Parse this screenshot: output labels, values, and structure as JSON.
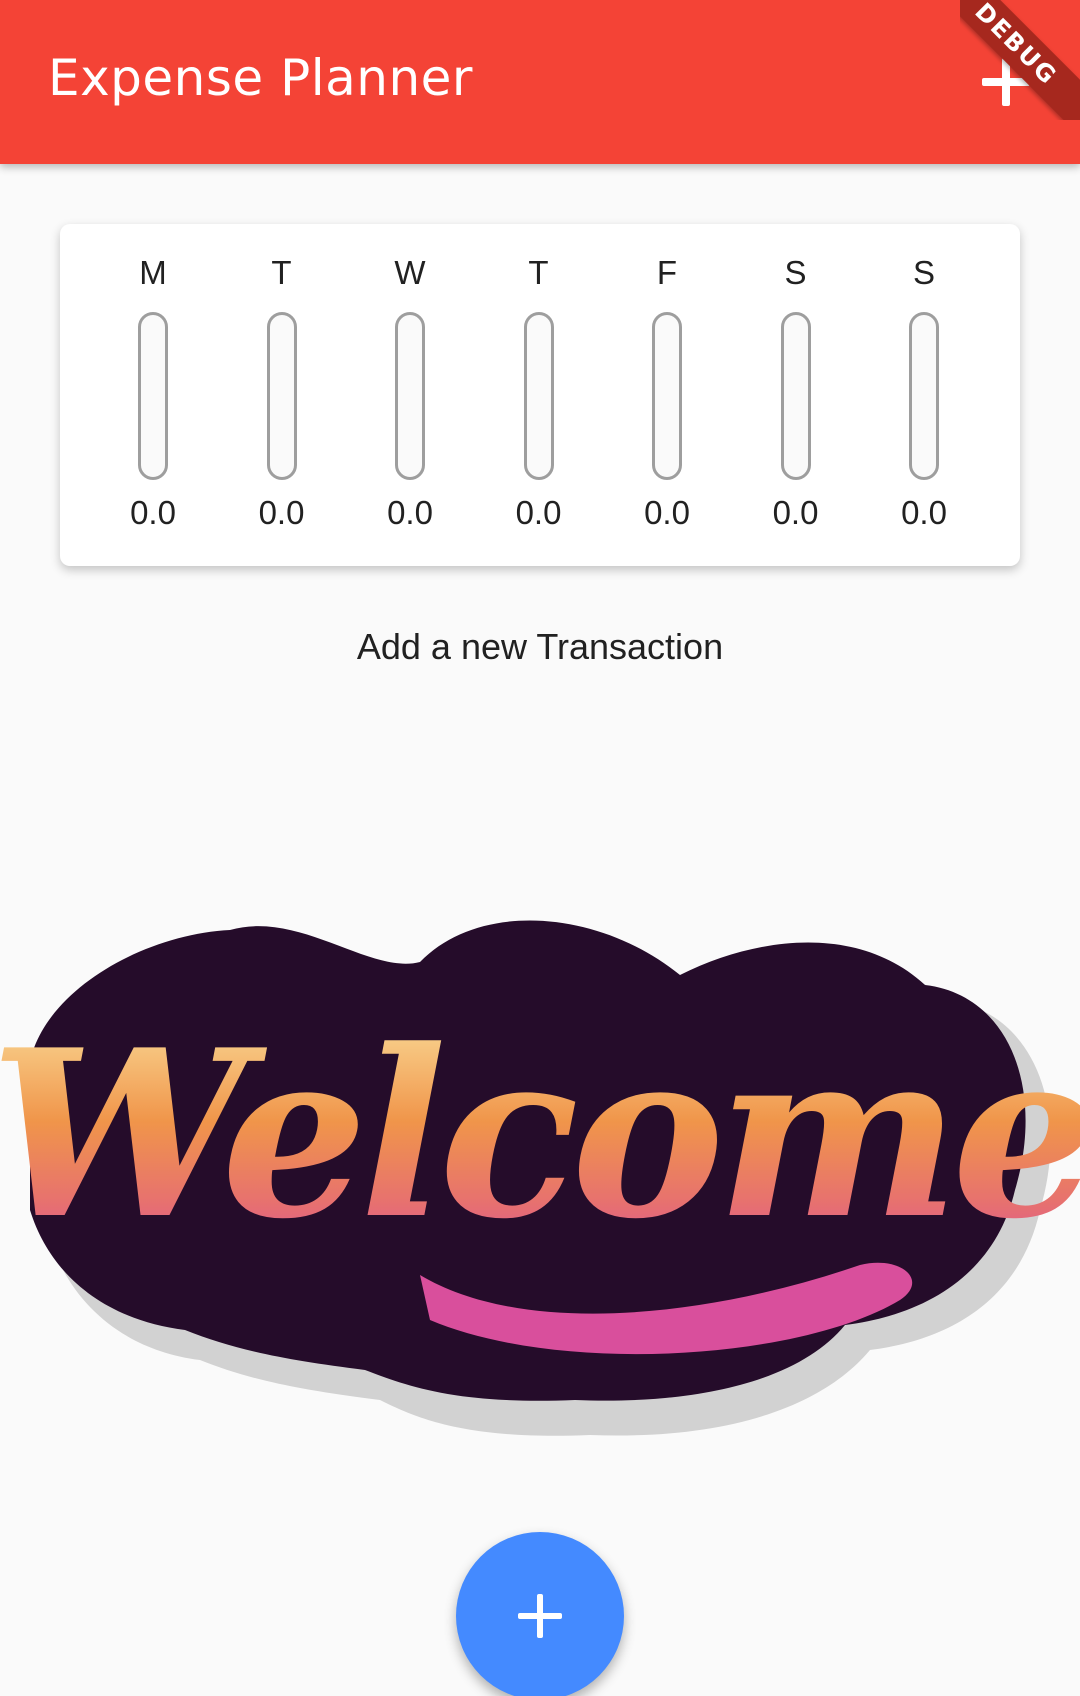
{
  "appbar": {
    "title": "Expense Planner",
    "add_icon": "plus-icon",
    "debug_label": "DEBUG",
    "color": "#f44336"
  },
  "chart": {
    "bars": [
      {
        "day": "M",
        "amount": "0.0",
        "fill": 0
      },
      {
        "day": "T",
        "amount": "0.0",
        "fill": 0
      },
      {
        "day": "W",
        "amount": "0.0",
        "fill": 0
      },
      {
        "day": "T",
        "amount": "0.0",
        "fill": 0
      },
      {
        "day": "F",
        "amount": "0.0",
        "fill": 0
      },
      {
        "day": "S",
        "amount": "0.0",
        "fill": 0
      },
      {
        "day": "S",
        "amount": "0.0",
        "fill": 0
      }
    ]
  },
  "empty_state": {
    "title": "Add a new Transaction",
    "image_text": "Welcome"
  },
  "fab": {
    "icon": "plus-icon",
    "color": "#448aff"
  }
}
